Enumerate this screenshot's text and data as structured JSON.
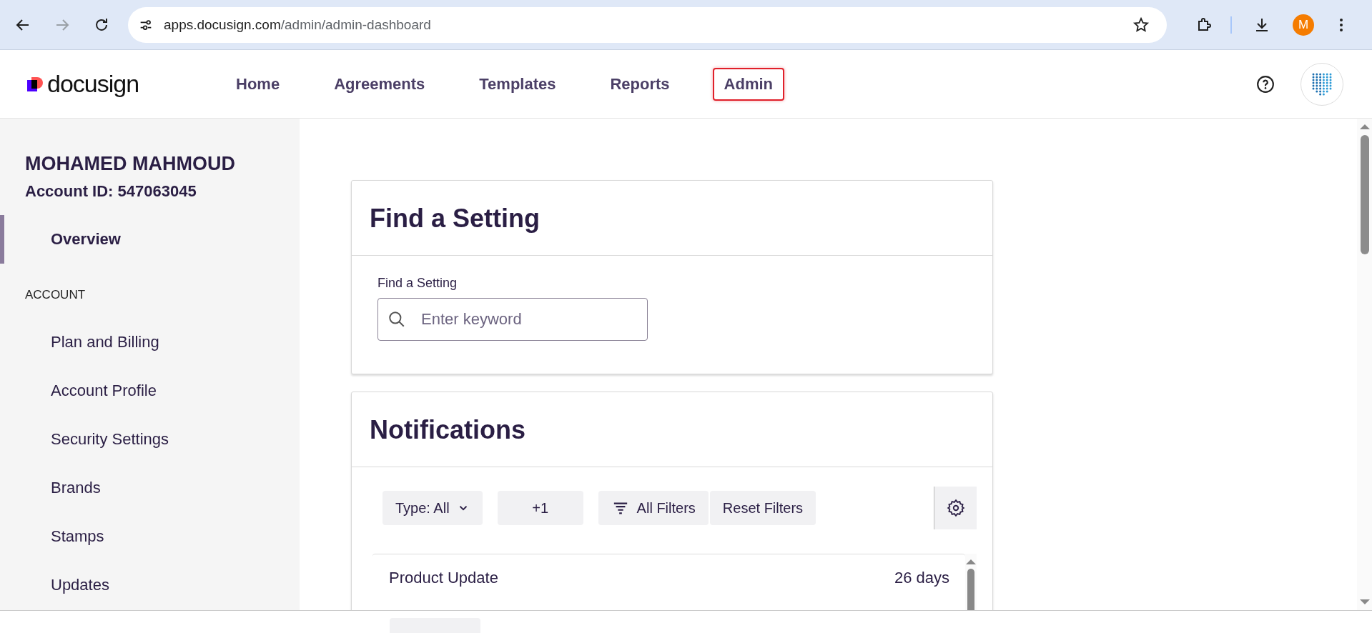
{
  "browser": {
    "url_host": "apps.docusign.com",
    "url_path": "/admin/admin-dashboard",
    "profile_initial": "M"
  },
  "header": {
    "logo_text": "docusign",
    "nav": [
      {
        "label": "Home",
        "highlighted": false
      },
      {
        "label": "Agreements",
        "highlighted": false
      },
      {
        "label": "Templates",
        "highlighted": false
      },
      {
        "label": "Reports",
        "highlighted": false
      },
      {
        "label": "Admin",
        "highlighted": true
      }
    ]
  },
  "sidebar": {
    "user_name": "MOHAMED MAHMOUD",
    "account_id": "Account ID: 547063045",
    "items": [
      {
        "label": "Overview",
        "kind": "item",
        "selected": true
      },
      {
        "label": "ACCOUNT",
        "kind": "section"
      },
      {
        "label": "Plan and Billing",
        "kind": "item",
        "selected": false
      },
      {
        "label": "Account Profile",
        "kind": "item",
        "selected": false
      },
      {
        "label": "Security Settings",
        "kind": "item",
        "selected": false
      },
      {
        "label": "Brands",
        "kind": "item",
        "selected": false
      },
      {
        "label": "Stamps",
        "kind": "item",
        "selected": false
      },
      {
        "label": "Updates",
        "kind": "item",
        "selected": false
      }
    ]
  },
  "find_setting": {
    "title": "Find a Setting",
    "label": "Find a Setting",
    "placeholder": "Enter keyword"
  },
  "notifications": {
    "title": "Notifications",
    "filters": [
      {
        "label": "Type: All",
        "kind": "dropdown"
      },
      {
        "label": "+1",
        "kind": "plain"
      },
      {
        "label": "All Filters",
        "kind": "filter"
      },
      {
        "label": "Reset Filters",
        "kind": "plain"
      }
    ],
    "rows": [
      {
        "title": "Product Update",
        "age": "26 days"
      }
    ]
  }
}
